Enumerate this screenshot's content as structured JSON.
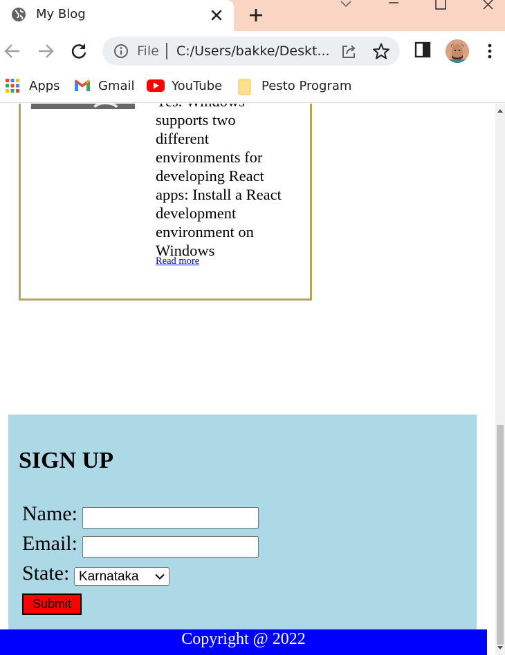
{
  "browser": {
    "tab": {
      "title": "My Blog"
    },
    "address": {
      "scheme_label": "File",
      "url": "C:/Users/bakke/Deskt..."
    },
    "bookmarks": [
      {
        "label": "Apps",
        "icon": "apps-grid-icon"
      },
      {
        "label": "Gmail",
        "icon": "gmail-icon"
      },
      {
        "label": "YouTube",
        "icon": "youtube-icon"
      },
      {
        "label": "Pesto Program",
        "icon": "folder-icon"
      }
    ],
    "colors": {
      "tabstrip": "#fbd5c4",
      "omnibox": "#eceff1"
    }
  },
  "page": {
    "post": {
      "excerpt_lines": [
        "Yes. Windows",
        "supports two",
        "different",
        "environments for",
        "developing React",
        "apps: Install a React",
        "development",
        "environment on",
        "Windows"
      ],
      "read_more": "Read more",
      "border_color": "#b4a55a"
    },
    "signup": {
      "title": "SIGN UP",
      "name_label": "Name:",
      "email_label": "Email:",
      "state_label": "State:",
      "state_selected": "Karnataka",
      "submit_label": "Submit",
      "background": "#add8e6",
      "submit_color": "#ff0000"
    },
    "footer": {
      "text": "Copyright @ 2022",
      "background": "#0000ff"
    }
  }
}
